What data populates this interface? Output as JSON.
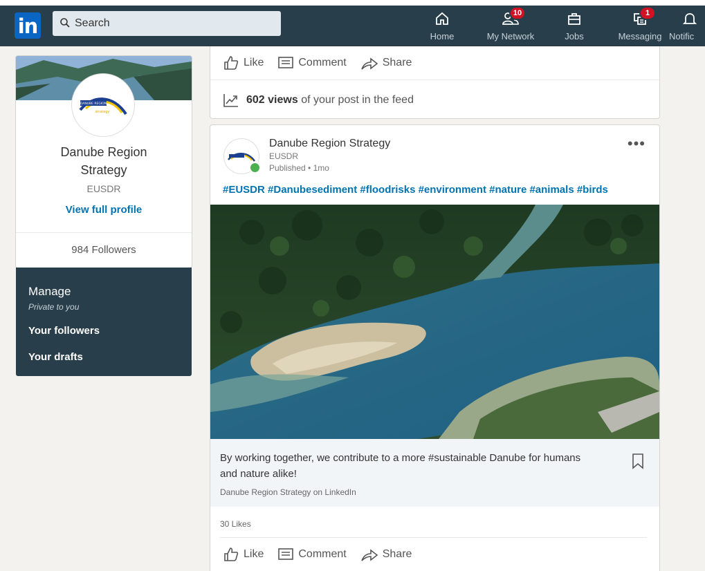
{
  "nav": {
    "search_placeholder": "Search",
    "items": [
      {
        "label": "Home",
        "icon": "home-icon"
      },
      {
        "label": "My Network",
        "icon": "network-icon",
        "badge": "10"
      },
      {
        "label": "Jobs",
        "icon": "briefcase-icon"
      },
      {
        "label": "Messaging",
        "icon": "messaging-icon",
        "badge": "1"
      },
      {
        "label": "Notific",
        "icon": "bell-icon"
      }
    ]
  },
  "profile": {
    "name": "Danube Region Strategy",
    "subtitle": "EUSDR",
    "view_profile": "View full profile",
    "followers": "984 Followers",
    "logo_text": "DANUBE REGION strategy"
  },
  "manage": {
    "title": "Manage",
    "privacy": "Private to you",
    "links": [
      "Your followers",
      "Your drafts"
    ]
  },
  "prev_post": {
    "actions": [
      "Like",
      "Comment",
      "Share"
    ],
    "views_count": "602 views",
    "views_suffix": "of your post in the feed"
  },
  "post": {
    "author": "Danube Region Strategy",
    "author_sub": "EUSDR",
    "meta": "Published • 1mo",
    "hashtags": "#EUSDR #Danubesediment #floodrisks #environment #nature #animals #birds",
    "caption": "By working together, we contribute to a more #sustainable Danube for humans and nature alike!",
    "source": "Danube Region Strategy on LinkedIn",
    "likes": "30 Likes",
    "actions": [
      "Like",
      "Comment",
      "Share"
    ]
  },
  "colors": {
    "nav_bg": "#283e4a",
    "link_blue": "#0073b1",
    "badge_red": "#d11124",
    "online_green": "#4caf50"
  }
}
